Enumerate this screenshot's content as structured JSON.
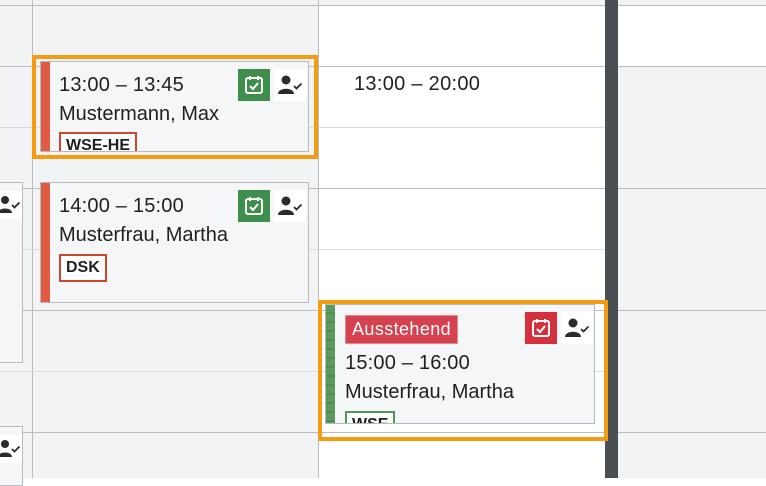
{
  "appointments": [
    {
      "time": "13:00 – 13:45",
      "patient": "Mustermann, Max",
      "tag": "WSE-HE",
      "stripe_color": "#e15a44",
      "icons": [
        "calendar-check-icon",
        "person-check-icon"
      ],
      "selected": true
    },
    {
      "time": "14:00 – 15:00",
      "patient": "Musterfrau, Martha",
      "tag": "DSK",
      "stripe_color": "#e15a44",
      "icons": [
        "calendar-check-icon",
        "person-check-icon"
      ],
      "selected": false
    },
    {
      "status": "Ausstehend",
      "time": "15:00 – 16:00",
      "patient": "Musterfrau, Martha",
      "tag": "WSE",
      "stripe_color": "#5a9a5c",
      "icons": [
        "calendar-check-icon",
        "person-check-icon"
      ],
      "selected": true
    }
  ],
  "availability": {
    "time": "13:00 – 20:00"
  },
  "colors": {
    "selection_outline": "#f39c12",
    "confirmed_icon_bg": "#3f8e4b",
    "pending_icon_bg": "#d5313d",
    "pending_badge_bg": "#d5414f",
    "divider": "#4a4f54"
  }
}
